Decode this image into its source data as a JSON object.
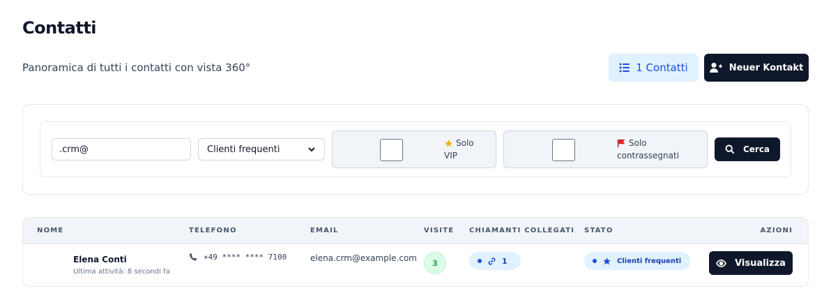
{
  "page": {
    "title": "Contatti",
    "subtitle": "Panoramica di tutti i contatti con vista 360°"
  },
  "header_actions": {
    "count_label": "1 Contatti",
    "new_contact_label": "Neuer Kontakt"
  },
  "filters": {
    "search_value": ".crm@",
    "segment_selected": "Clienti frequenti",
    "vip_label_line1": "Solo",
    "vip_label_line2": "VIP",
    "vip_checked": false,
    "flagged_label_line1": "Solo",
    "flagged_label_line2": "contrassegnati",
    "flagged_checked": false,
    "search_button_label": "Cerca",
    "star_color": "#eab308",
    "flag_color": "#dc2626"
  },
  "table": {
    "columns": {
      "name": "NOME",
      "phone": "TELEFONO",
      "email": "EMAIL",
      "visits": "VISITE",
      "linked_callers": "CHIAMANTI COLLEGATI",
      "status": "STATO",
      "actions": "AZIONI"
    },
    "rows": [
      {
        "name": "Elena Conti",
        "last_activity": "Ultima attività: 8 secondi fa",
        "phone": "+49 **** **** 7100",
        "email": "elena.crm@example.com",
        "visits": "3",
        "linked_callers": "1",
        "status": "Clienti frequenti",
        "action_label": "Visualizza"
      }
    ]
  },
  "colors": {
    "primary_dark": "#0f172a",
    "accent_blue": "#1d4ed8",
    "badge_bg": "#e0f2fe",
    "visits_green": "#16a34a"
  }
}
